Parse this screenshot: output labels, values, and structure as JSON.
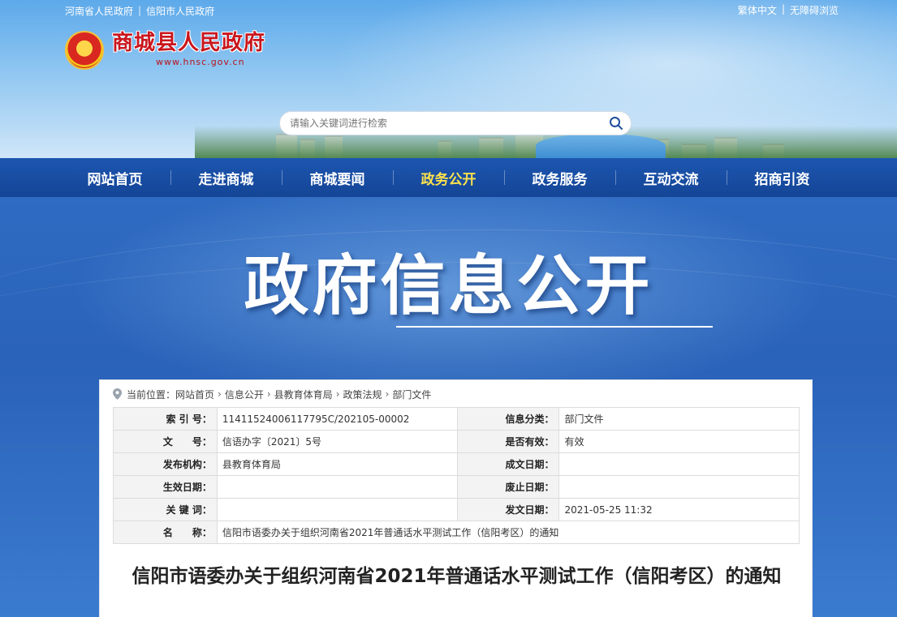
{
  "header": {
    "top_links": [
      "河南省人民政府",
      "信阳市人民政府"
    ],
    "top_right": [
      "繁体中文",
      "无障碍浏览"
    ],
    "site_title": "商城县人民政府",
    "site_url": "www.hnsc.gov.cn",
    "search_placeholder": "请输入关键词进行检索"
  },
  "nav": {
    "items": [
      "网站首页",
      "走进商城",
      "商城要闻",
      "政务公开",
      "政务服务",
      "互动交流",
      "招商引资"
    ],
    "active": "政务公开"
  },
  "banner": {
    "title": "政府信息公开"
  },
  "breadcrumb": {
    "prefix": "当前位置：",
    "items": [
      "网站首页",
      "信息公开",
      "县教育体育局",
      "政策法规",
      "部门文件"
    ]
  },
  "info": {
    "index_no_label": "索 引 号：",
    "index_no": "11411524006117795C/202105-00002",
    "category_label": "信息分类：",
    "category": "部门文件",
    "doc_no_label": "文　　号：",
    "doc_no": "信语办字〔2021〕5号",
    "valid_label": "是否有效：",
    "valid": "有效",
    "publisher_label": "发布机构：",
    "publisher": "县教育体育局",
    "created_label": "成文日期：",
    "created": "",
    "effective_label": "生效日期：",
    "effective": "",
    "abolished_label": "废止日期：",
    "abolished": "",
    "keywords_label": "关 键 词：",
    "keywords": "",
    "published_label": "发文日期：",
    "published": "2021-05-25 11:32",
    "name_label": "名　　称：",
    "name": "信阳市语委办关于组织河南省2021年普通话水平测试工作（信阳考区）的通知"
  },
  "document": {
    "title": "信阳市语委办关于组织河南省2021年普通话水平测试工作（信阳考区）的通知"
  },
  "colors": {
    "nav_bg": "#1a4fa6",
    "nav_active": "#ffe24a",
    "brand_red": "#c9161d",
    "banner_bg": "#2c5fb2"
  },
  "icons": [
    "emblem-icon",
    "search-icon",
    "location-pin-icon"
  ]
}
